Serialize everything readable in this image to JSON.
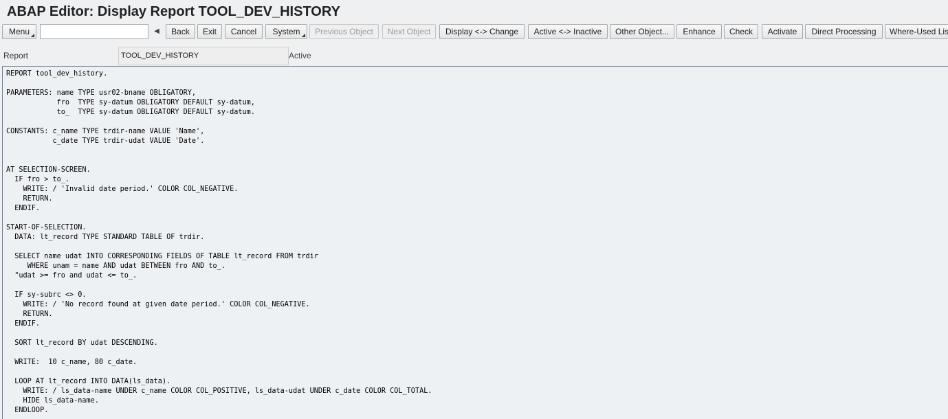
{
  "window": {
    "title": "ABAP Editor: Display Report TOOL_DEV_HISTORY"
  },
  "toolbar": {
    "menu_label": "Menu",
    "command_field_value": "",
    "back_label": "Back",
    "exit_label": "Exit",
    "cancel_label": "Cancel",
    "system_label": "System",
    "previous_object_label": "Previous Object",
    "next_object_label": "Next Object",
    "display_change_label": "Display <-> Change",
    "active_inactive_label": "Active <-> Inactive",
    "other_object_label": "Other Object...",
    "enhance_label": "Enhance",
    "check_label": "Check",
    "activate_label": "Activate",
    "direct_processing_label": "Direct Processing",
    "where_used_label": "Where-Used List"
  },
  "header": {
    "report_label": "Report",
    "report_value": "TOOL_DEV_HISTORY",
    "status": "Active"
  },
  "editor": {
    "lines": [
      "REPORT tool_dev_history.",
      "",
      "PARAMETERS: name TYPE usr02-bname OBLIGATORY,",
      "            fro  TYPE sy-datum OBLIGATORY DEFAULT sy-datum,",
      "            to_  TYPE sy-datum OBLIGATORY DEFAULT sy-datum.",
      "",
      "CONSTANTS: c_name TYPE trdir-name VALUE 'Name',",
      "           c_date TYPE trdir-udat VALUE 'Date'.",
      "",
      "",
      "AT SELECTION-SCREEN.",
      "  IF fro > to_.",
      "    WRITE: / 'Invalid date period.' COLOR COL_NEGATIVE.",
      "    RETURN.",
      "  ENDIF.",
      "",
      "START-OF-SELECTION.",
      "  DATA: lt_record TYPE STANDARD TABLE OF trdir.",
      "",
      "  SELECT name udat INTO CORRESPONDING FIELDS OF TABLE lt_record FROM trdir",
      "     WHERE unam = name AND udat BETWEEN fro AND to_.",
      "  \"udat >= fro and udat <= to_.",
      "",
      "  IF sy-subrc <> 0.",
      "    WRITE: / 'No record found at given date period.' COLOR COL_NEGATIVE.",
      "    RETURN.",
      "  ENDIF.",
      "",
      "  SORT lt_record BY udat DESCENDING.",
      "",
      "  WRITE:  10 c_name, 80 c_date.",
      "",
      "  LOOP AT lt_record INTO DATA(ls_data).",
      "    WRITE: / ls_data-name UNDER c_name COLOR COL_POSITIVE, ls_data-udat UNDER c_date COLOR COL_TOTAL.",
      "    HIDE ls_data-name.",
      "  ENDLOOP."
    ]
  }
}
